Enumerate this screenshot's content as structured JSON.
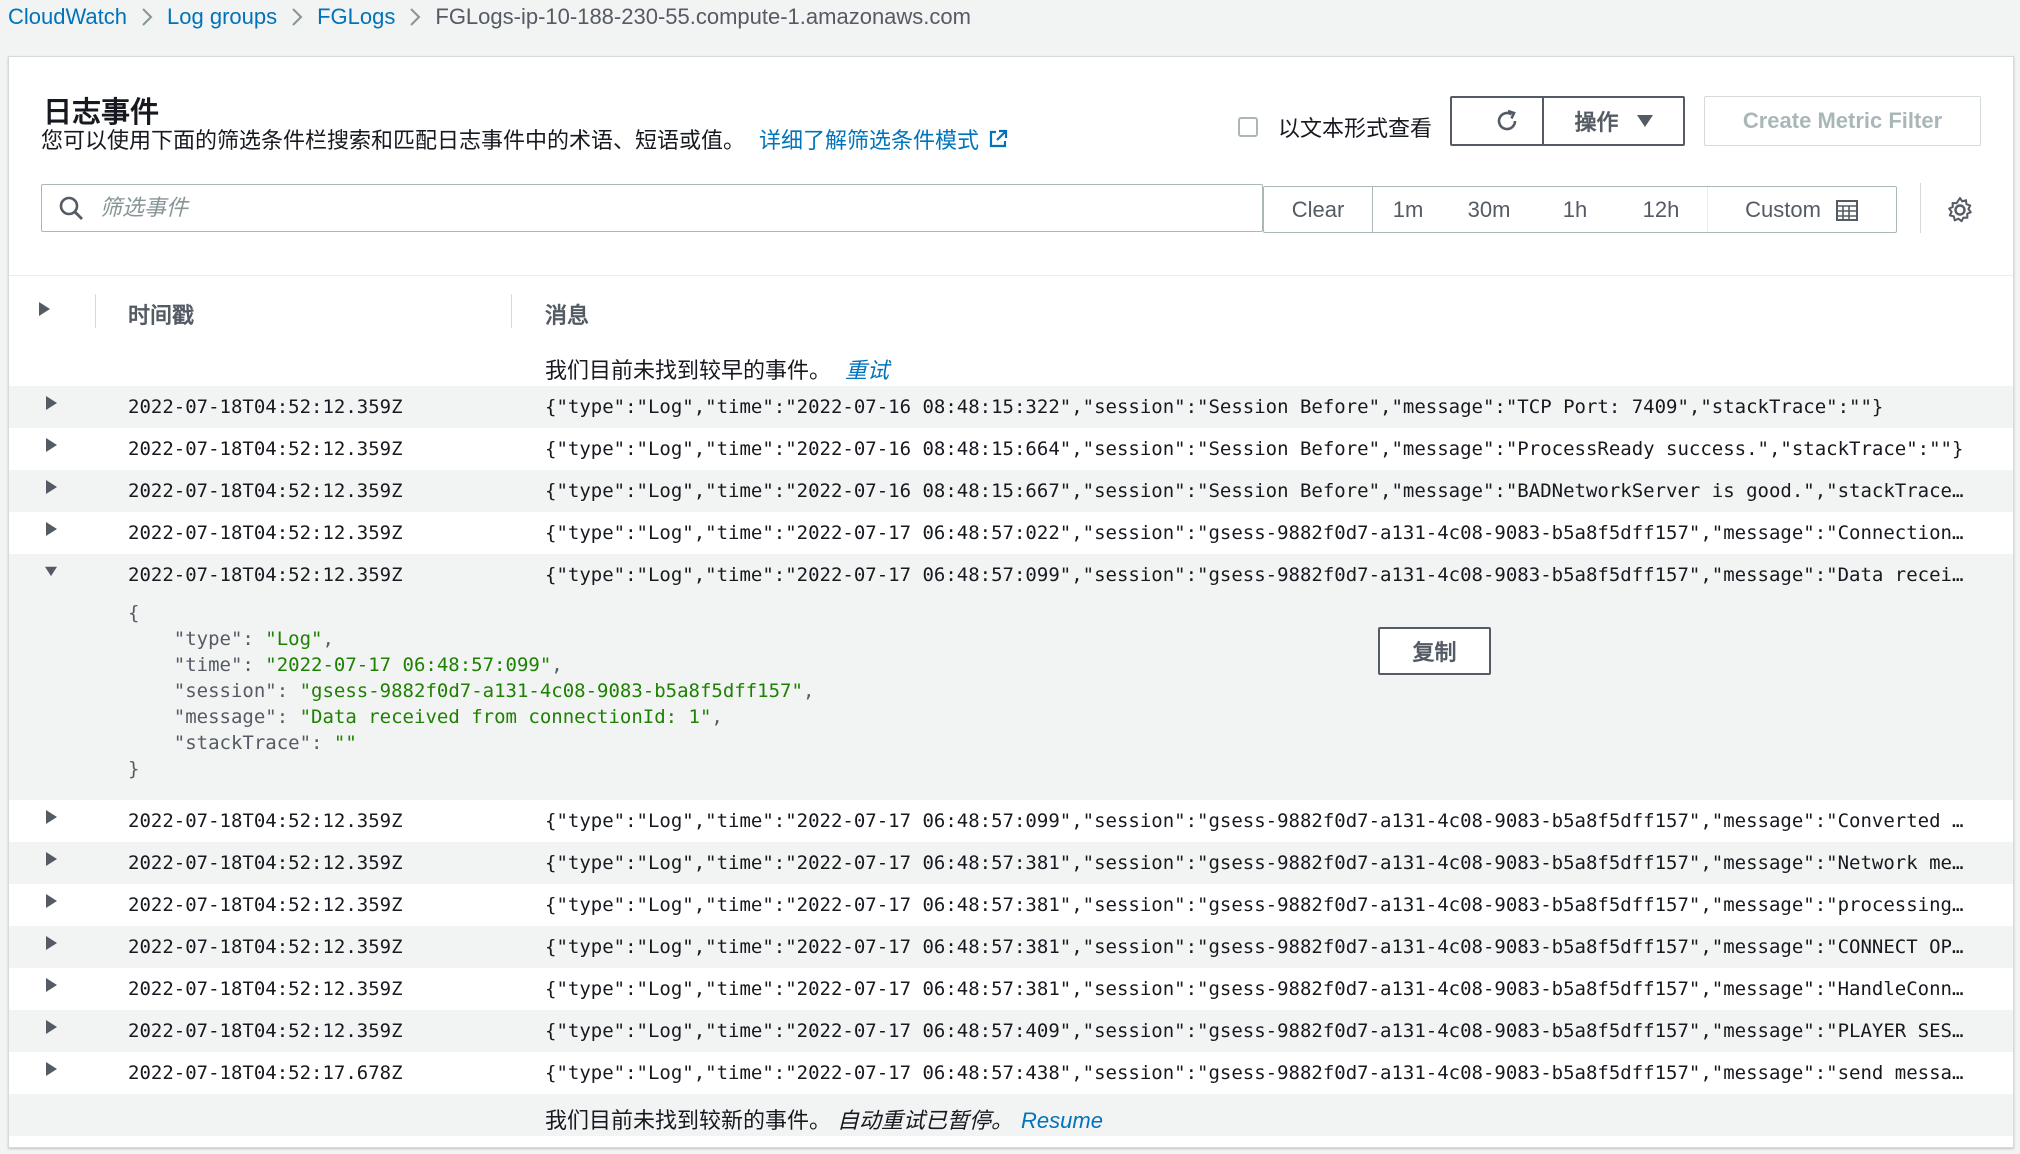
{
  "breadcrumb": [
    {
      "label": "CloudWatch"
    },
    {
      "label": "Log groups"
    },
    {
      "label": "FGLogs"
    },
    {
      "label": "FGLogs-ip-10-188-230-55.compute-1.amazonaws.com"
    }
  ],
  "panel": {
    "title": "日志事件",
    "description": "您可以使用下面的筛选条件栏搜索和匹配日志事件中的术语、短语或值。",
    "learn_more": "详细了解筛选条件模式",
    "text_view_label": "以文本形式查看",
    "actions_label": "操作",
    "create_metric_filter": "Create Metric Filter"
  },
  "search": {
    "placeholder": "筛选事件",
    "value": ""
  },
  "time_range": {
    "clear": "Clear",
    "options": [
      "1m",
      "30m",
      "1h",
      "12h"
    ],
    "custom": "Custom"
  },
  "table": {
    "col_timestamp": "时间戳",
    "col_message": "消息",
    "top_notice": "我们目前未找到较早的事件。",
    "top_retry": "重试",
    "bottom_notice": "我们目前未找到较新的事件。",
    "bottom_paused": "自动重试已暂停。",
    "bottom_resume": "Resume",
    "rows": [
      {
        "timestamp": "2022-07-18T04:52:12.359Z",
        "message": "{\"type\":\"Log\",\"time\":\"2022-07-16 08:48:15:322\",\"session\":\"Session Before\",\"message\":\"TCP Port: 7409\",\"stackTrace\":\"\"}"
      },
      {
        "timestamp": "2022-07-18T04:52:12.359Z",
        "message": "{\"type\":\"Log\",\"time\":\"2022-07-16 08:48:15:664\",\"session\":\"Session Before\",\"message\":\"ProcessReady success.\",\"stackTrace\":\"\"}"
      },
      {
        "timestamp": "2022-07-18T04:52:12.359Z",
        "message": "{\"type\":\"Log\",\"time\":\"2022-07-16 08:48:15:667\",\"session\":\"Session Before\",\"message\":\"BADNetworkServer is good.\",\"stackTrace…"
      },
      {
        "timestamp": "2022-07-18T04:52:12.359Z",
        "message": "{\"type\":\"Log\",\"time\":\"2022-07-17 06:48:57:022\",\"session\":\"gsess-9882f0d7-a131-4c08-9083-b5a8f5dff157\",\"message\":\"Connection…"
      },
      {
        "timestamp": "2022-07-18T04:52:12.359Z",
        "message": "{\"type\":\"Log\",\"time\":\"2022-07-17 06:48:57:099\",\"session\":\"gsess-9882f0d7-a131-4c08-9083-b5a8f5dff157\",\"message\":\"Data recei…"
      },
      {
        "timestamp": "2022-07-18T04:52:12.359Z",
        "message": "{\"type\":\"Log\",\"time\":\"2022-07-17 06:48:57:099\",\"session\":\"gsess-9882f0d7-a131-4c08-9083-b5a8f5dff157\",\"message\":\"Converted …"
      },
      {
        "timestamp": "2022-07-18T04:52:12.359Z",
        "message": "{\"type\":\"Log\",\"time\":\"2022-07-17 06:48:57:381\",\"session\":\"gsess-9882f0d7-a131-4c08-9083-b5a8f5dff157\",\"message\":\"Network me…"
      },
      {
        "timestamp": "2022-07-18T04:52:12.359Z",
        "message": "{\"type\":\"Log\",\"time\":\"2022-07-17 06:48:57:381\",\"session\":\"gsess-9882f0d7-a131-4c08-9083-b5a8f5dff157\",\"message\":\"processing…"
      },
      {
        "timestamp": "2022-07-18T04:52:12.359Z",
        "message": "{\"type\":\"Log\",\"time\":\"2022-07-17 06:48:57:381\",\"session\":\"gsess-9882f0d7-a131-4c08-9083-b5a8f5dff157\",\"message\":\"CONNECT OP…"
      },
      {
        "timestamp": "2022-07-18T04:52:12.359Z",
        "message": "{\"type\":\"Log\",\"time\":\"2022-07-17 06:48:57:381\",\"session\":\"gsess-9882f0d7-a131-4c08-9083-b5a8f5dff157\",\"message\":\"HandleConn…"
      },
      {
        "timestamp": "2022-07-18T04:52:12.359Z",
        "message": "{\"type\":\"Log\",\"time\":\"2022-07-17 06:48:57:409\",\"session\":\"gsess-9882f0d7-a131-4c08-9083-b5a8f5dff157\",\"message\":\"PLAYER SES…"
      },
      {
        "timestamp": "2022-07-18T04:52:17.678Z",
        "message": "{\"type\":\"Log\",\"time\":\"2022-07-17 06:48:57:438\",\"session\":\"gsess-9882f0d7-a131-4c08-9083-b5a8f5dff157\",\"message\":\"send messa…"
      }
    ],
    "expanded": {
      "open_brace": "{",
      "close_brace": "}",
      "fields": [
        {
          "key": "\"type\": ",
          "value": "\"Log\"",
          "comma": ","
        },
        {
          "key": "\"time\": ",
          "value": "\"2022-07-17 06:48:57:099\"",
          "comma": ","
        },
        {
          "key": "\"session\": ",
          "value": "\"gsess-9882f0d7-a131-4c08-9083-b5a8f5dff157\"",
          "comma": ","
        },
        {
          "key": "\"message\": ",
          "value": "\"Data received from connectionId: 1\"",
          "comma": ","
        },
        {
          "key": "\"stackTrace\": ",
          "value": "\"\"",
          "comma": ""
        }
      ],
      "copy_label": "复制"
    }
  }
}
